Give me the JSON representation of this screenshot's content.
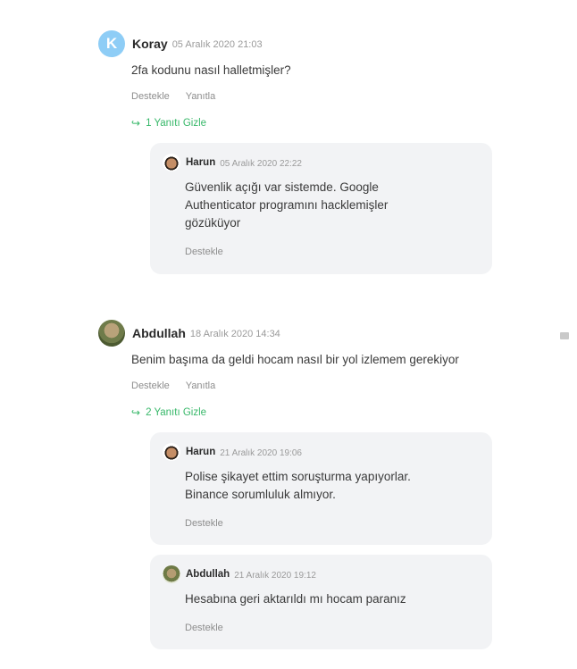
{
  "comments": [
    {
      "avatar_letter": "K",
      "name": "Koray",
      "date": "05 Aralık 2020 21:03",
      "text": "2fa kodunu nasıl halletmişler?",
      "like_label": "Destekle",
      "reply_label": "Yanıtla",
      "toggle_label": "1 Yanıtı Gizle",
      "replies": [
        {
          "name": "Harun",
          "date": "05 Aralık 2020 22:22",
          "text": "Güvenlik açığı var sistemde. Google Authenticator programını hacklemişler gözüküyor",
          "like_label": "Destekle"
        }
      ]
    },
    {
      "name": "Abdullah",
      "date": "18 Aralık 2020 14:34",
      "text": "Benim başıma da geldi hocam nasıl bir yol izlemem gerekiyor",
      "like_label": "Destekle",
      "reply_label": "Yanıtla",
      "toggle_label": "2 Yanıtı Gizle",
      "replies": [
        {
          "name": "Harun",
          "date": "21 Aralık 2020 19:06",
          "text": "Polise şikayet ettim soruşturma yapıyorlar. Binance sorumluluk almıyor.",
          "like_label": "Destekle"
        },
        {
          "name": "Abdullah",
          "date": "21 Aralık 2020 19:12",
          "text": "Hesabına geri aktarıldı mı hocam paranız",
          "like_label": "Destekle"
        }
      ]
    }
  ],
  "colors": {
    "accent_green": "#38b86a",
    "avatar_letter_bg": "#8ecdf6",
    "reply_bg": "#f2f3f5"
  },
  "icons": [
    "reply-arrow-icon",
    "flag-icon"
  ]
}
